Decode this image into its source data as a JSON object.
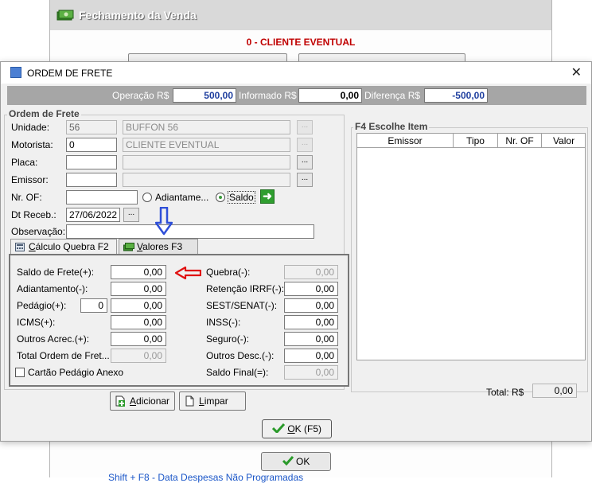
{
  "background": {
    "title": "Fechamento da Venda",
    "client": "0 - CLIENTE EVENTUAL",
    "ok_label": "OK",
    "link_text": "Shift + F8 - Data Despesas Não Programadas"
  },
  "dialog": {
    "title": "ORDEM DE FRETE",
    "operation_bar": {
      "operacao_label": "Operação R$",
      "operacao_value": "500,00",
      "informado_label": "Informado R$",
      "informado_value": "0,00",
      "diferenca_label": "Diferença R$",
      "diferenca_value": "-500,00"
    },
    "ordem_group": {
      "legend": "Ordem de Frete",
      "unidade_label": "Unidade:",
      "unidade_code": "56",
      "unidade_name": "BUFFON 56",
      "motorista_label": "Motorista:",
      "motorista_code": "0",
      "motorista_name": "CLIENTE EVENTUAL",
      "placa_label": "Placa:",
      "emissor_label": "Emissor:",
      "nr_of_label": "Nr. OF:",
      "adiantamento_label": "Adiantame...",
      "saldo_label": "Saldo",
      "dt_receb_label": "Dt Receb.:",
      "dt_receb_value": "27/06/2022",
      "observacao_label": "Observação:",
      "browse_glyph": "..."
    },
    "tabs": [
      {
        "key": "C",
        "rest": "álculo Quebra  F2"
      },
      {
        "key": "V",
        "rest": "alores  F3"
      }
    ],
    "calc": {
      "left": [
        {
          "label": "Saldo de Frete(+):",
          "value": "0,00"
        },
        {
          "label": "Adiantamento(-):",
          "value": "0,00"
        },
        {
          "label": "Pedágio(+):",
          "value": "0,00",
          "qty": "0"
        },
        {
          "label": "ICMS(+):",
          "value": "0,00"
        },
        {
          "label": "Outros Acrec.(+):",
          "value": "0,00"
        },
        {
          "label": "Total Ordem de Fret...",
          "value": "0,00"
        }
      ],
      "right": [
        {
          "label": "Quebra(-):",
          "value": "0,00"
        },
        {
          "label": "Retenção IRRF(-):",
          "value": "0,00"
        },
        {
          "label": "SEST/SENAT(-):",
          "value": "0,00"
        },
        {
          "label": "INSS(-):",
          "value": "0,00"
        },
        {
          "label": "Seguro(-):",
          "value": "0,00"
        },
        {
          "label": "Outros Desc.(-):",
          "value": "0,00"
        },
        {
          "label": "Saldo Final(=):",
          "value": "0,00"
        }
      ],
      "cartao_label": "Cartão Pedágio Anexo"
    },
    "items_group": {
      "legend": "F4 Escolhe Item",
      "columns": [
        "Emissor",
        "Tipo",
        "Nr. OF",
        "Valor"
      ],
      "total_label": "Total: R$",
      "total_value": "0,00"
    },
    "buttons": {
      "adicionar_key": "A",
      "adicionar_rest": "dicionar",
      "limpar_key": "L",
      "limpar_rest": "impar",
      "ok_key": "O",
      "ok_rest": "K (F5)"
    },
    "colors": {
      "arrow_blue": "#2f4fd8",
      "arrow_red": "#e01010",
      "value_blue": "#1f3f9f",
      "header_gray": "#a6a6a6"
    }
  }
}
